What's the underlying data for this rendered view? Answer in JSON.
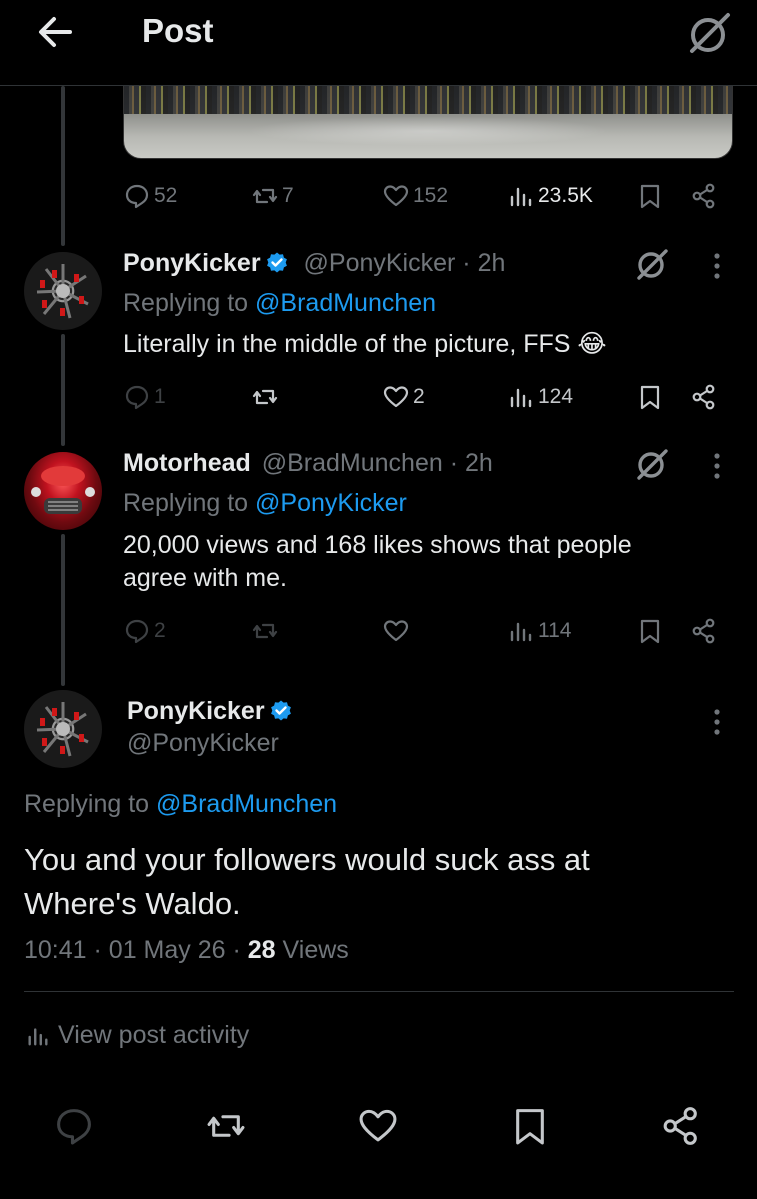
{
  "header": {
    "title": "Post",
    "back_icon": "arrow-left-icon",
    "grok_icon": "grok-icon"
  },
  "post": {
    "stats": {
      "replies": "52",
      "reposts": "7",
      "likes": "152",
      "views": "23.5K"
    }
  },
  "replies": [
    {
      "name": "PonyKicker",
      "handle": "@PonyKicker",
      "time": "· 2h",
      "replying_prefix": "Replying to",
      "replying_to": "@BradMunchen",
      "text": "Literally in the middle of the picture, FFS",
      "emoji": "😂",
      "stats": {
        "replies": "1",
        "reposts": "",
        "likes": "2",
        "views": "124"
      }
    },
    {
      "name": "Motorhead",
      "handle": "@BradMunchen",
      "time": "· 2h",
      "replying_prefix": "Replying to",
      "replying_to": "@PonyKicker",
      "text_line1": "20,000 views and 168 likes shows that people",
      "text_line2": "agree with me.",
      "stats": {
        "replies": "2",
        "reposts": "",
        "likes": "",
        "views": "114"
      }
    }
  ],
  "main": {
    "name": "PonyKicker",
    "handle": "@PonyKicker",
    "replying_prefix": "Replying to",
    "replying_to": "@BradMunchen",
    "text_line1": "You and your followers would suck ass at",
    "text_line2": "Where's Waldo.",
    "time": "10:41",
    "date": "01 May 26",
    "views_count": "28",
    "views_label": "Views",
    "sep": "·"
  },
  "activity": {
    "label": "View post activity"
  },
  "colors": {
    "accent": "#1d9bf0",
    "muted": "#71767b",
    "text": "#e7e9ea",
    "background": "#000000"
  }
}
